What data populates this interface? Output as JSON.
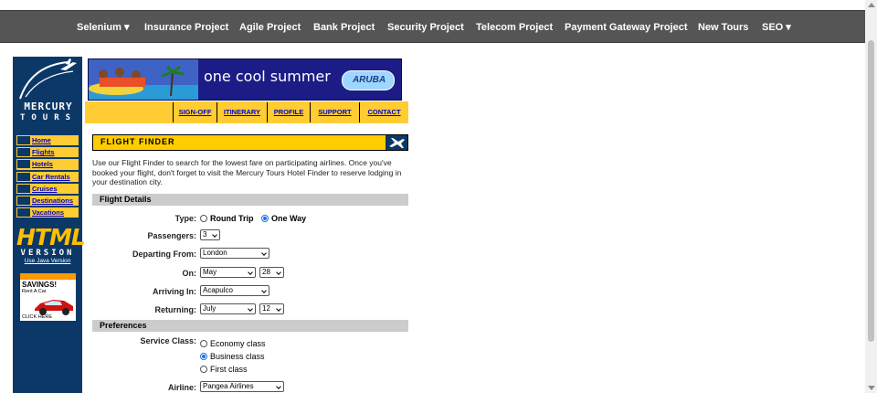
{
  "nav": {
    "items": [
      "Selenium ▾",
      "Insurance Project",
      "Agile Project",
      "Bank Project",
      "Security Project",
      "Telecom Project",
      "Payment Gateway Project",
      "New Tours",
      "SEO ▾"
    ]
  },
  "logo": {
    "line1": "MERCURY",
    "line2": "TOURS"
  },
  "sidemenu": [
    "Home",
    "Flights",
    "Hotels",
    "Car Rentals",
    "Cruises",
    "Destinations",
    "Vacations"
  ],
  "badge": {
    "html": "HTML",
    "version": "VERSION",
    "java_link": "Use Java Version"
  },
  "ad": {
    "savings": "SAVINGS!",
    "rent": "Rent A Car",
    "click": "CLICK HERE"
  },
  "banner": {
    "text": "one cool summer",
    "aruba": "ARUBA"
  },
  "linkbar": [
    "SIGN-OFF",
    "ITINERARY",
    "PROFILE",
    "SUPPORT",
    "CONTACT"
  ],
  "finder": {
    "title": "FLIGHT FINDER",
    "intro": "Use our Flight Finder to search for the lowest fare on participating airlines. Once you've booked your flight, don't forget to visit the Mercury Tours Hotel Finder to reserve lodging in your destination city.",
    "details_header": "Flight Details",
    "type_label": "Type:",
    "type_round": "Round Trip",
    "type_oneway": "One Way",
    "passengers_label": "Passengers:",
    "passengers_value": "3",
    "departing_label": "Departing From:",
    "departing_value": "London",
    "on_label": "On:",
    "on_month": "May",
    "on_day": "28",
    "arriving_label": "Arriving In:",
    "arriving_value": "Acapulco",
    "returning_label": "Returning:",
    "returning_month": "July",
    "returning_day": "12",
    "prefs_header": "Preferences",
    "service_label": "Service Class:",
    "service_economy": "Economy class",
    "service_business": "Business class",
    "service_first": "First class",
    "airline_label": "Airline:",
    "airline_value": "Pangea Airlines"
  },
  "colors": {
    "navbar": "#555555",
    "sidebar": "#0c3867",
    "accent": "#ffcc33"
  }
}
